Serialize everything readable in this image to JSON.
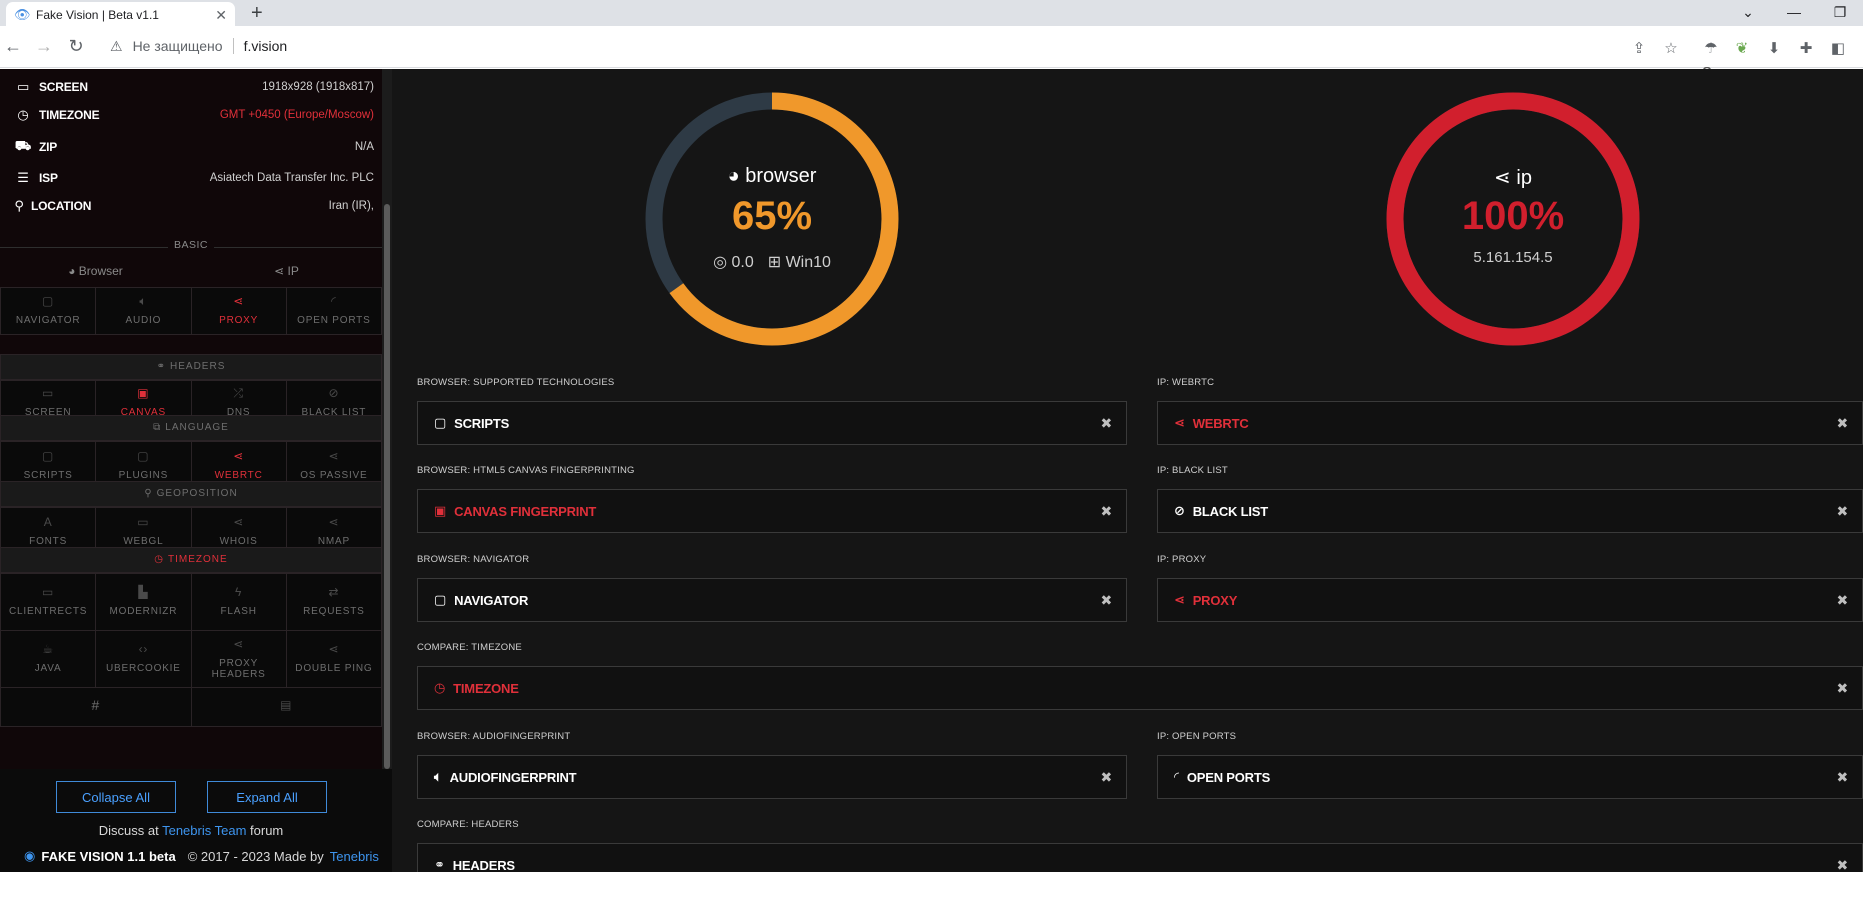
{
  "browser": {
    "tab_title": "Fake Vision | Beta v1.1",
    "security_label": "Не защищено",
    "url": "f.vision",
    "extension_badge": "2"
  },
  "sidebar": {
    "info": [
      {
        "label": "SCREEN",
        "icon": "monitor-icon",
        "value": "1918x928 (1918x817)",
        "value_color": "normal"
      },
      {
        "label": "TIMEZONE",
        "icon": "clock-icon",
        "value": "GMT +0450 (Europe/Moscow)",
        "value_color": "red"
      },
      {
        "label": "ZIP",
        "icon": "truck-icon",
        "value": "N/A",
        "value_color": "normal"
      },
      {
        "label": "ISP",
        "icon": "server-icon",
        "value": "Asiatech Data Transfer Inc. PLC",
        "value_color": "normal"
      },
      {
        "label": "LOCATION",
        "icon": "map-pin-icon",
        "value": "Iran (IR),",
        "value_color": "normal"
      }
    ],
    "basic_label": "BASIC",
    "basic_tabs": [
      "Browser",
      "IP"
    ],
    "row1": [
      "NAVIGATOR",
      "AUDIO",
      "PROXY",
      "OPEN PORTS"
    ],
    "headers_label": "HEADERS",
    "row2": [
      "SCREEN",
      "CANVAS",
      "DNS",
      "BLACK LIST"
    ],
    "language_label": "LANGUAGE",
    "row3": [
      "SCRIPTS",
      "PLUGINS",
      "WEBRTC",
      "OS PASSIVE"
    ],
    "geoposition_label": "GEOPOSITION",
    "row4": [
      "FONTS",
      "WEBGL",
      "WHOIS",
      "NMAP"
    ],
    "timezone_label": "TIMEZONE",
    "row5": [
      "CLIENTRECTS",
      "MODERNIZR",
      "FLASH",
      "REQUESTS"
    ],
    "row6": [
      "JAVA",
      "UBERCOOKIE",
      "PROXY HEADERS",
      "DOUBLE PING"
    ],
    "collapse_label": "Collapse All",
    "expand_label": "Expand All",
    "discuss_prefix": "Discuss at",
    "discuss_link": "Tenebris Team",
    "discuss_suffix": "forum",
    "brand": "FAKE VISION 1.1 beta",
    "copyright": "© 2017 - 2023 Made by",
    "author_link": "Tenebris"
  },
  "scores": {
    "browser": {
      "title": "browser",
      "percent_text": "65%",
      "percent": 65,
      "chrome_version": "0.0",
      "os": "Win10",
      "color": "#f0982b"
    },
    "ip": {
      "title": "ip",
      "percent_text": "100%",
      "percent": 100,
      "address": "5.161.154.5",
      "color": "#d11f2d"
    }
  },
  "cards": {
    "scripts": {
      "label": "BROWSER: SUPPORTED TECHNOLOGIES",
      "title": "SCRIPTS"
    },
    "webrtc": {
      "label": "IP: WEBRTC",
      "title": "WEBRTC"
    },
    "canvas": {
      "label": "BROWSER: HTML5 CANVAS FINGERPRINTING",
      "title": "CANVAS FINGERPRINT"
    },
    "blacklist": {
      "label": "IP: BLACK LIST",
      "title": "BLACK LIST"
    },
    "navigator": {
      "label": "BROWSER: NAVIGATOR",
      "title": "NAVIGATOR"
    },
    "proxy": {
      "label": "IP: PROXY",
      "title": "PROXY"
    },
    "timezone": {
      "label": "COMPARE: TIMEZONE",
      "title": "TIMEZONE"
    },
    "audio": {
      "label": "BROWSER: AUDIOFINGERPRINT",
      "title": "AUDIOFINGERPRINT"
    },
    "ports": {
      "label": "IP: OPEN PORTS",
      "title": "OPEN PORTS"
    },
    "headers": {
      "label": "COMPARE: HEADERS",
      "title": "HEADERS"
    }
  },
  "colors": {
    "accent_red": "#e0303a",
    "link_blue": "#3e95ef",
    "orange": "#f0982b",
    "donut_track": "#2e3a45"
  }
}
